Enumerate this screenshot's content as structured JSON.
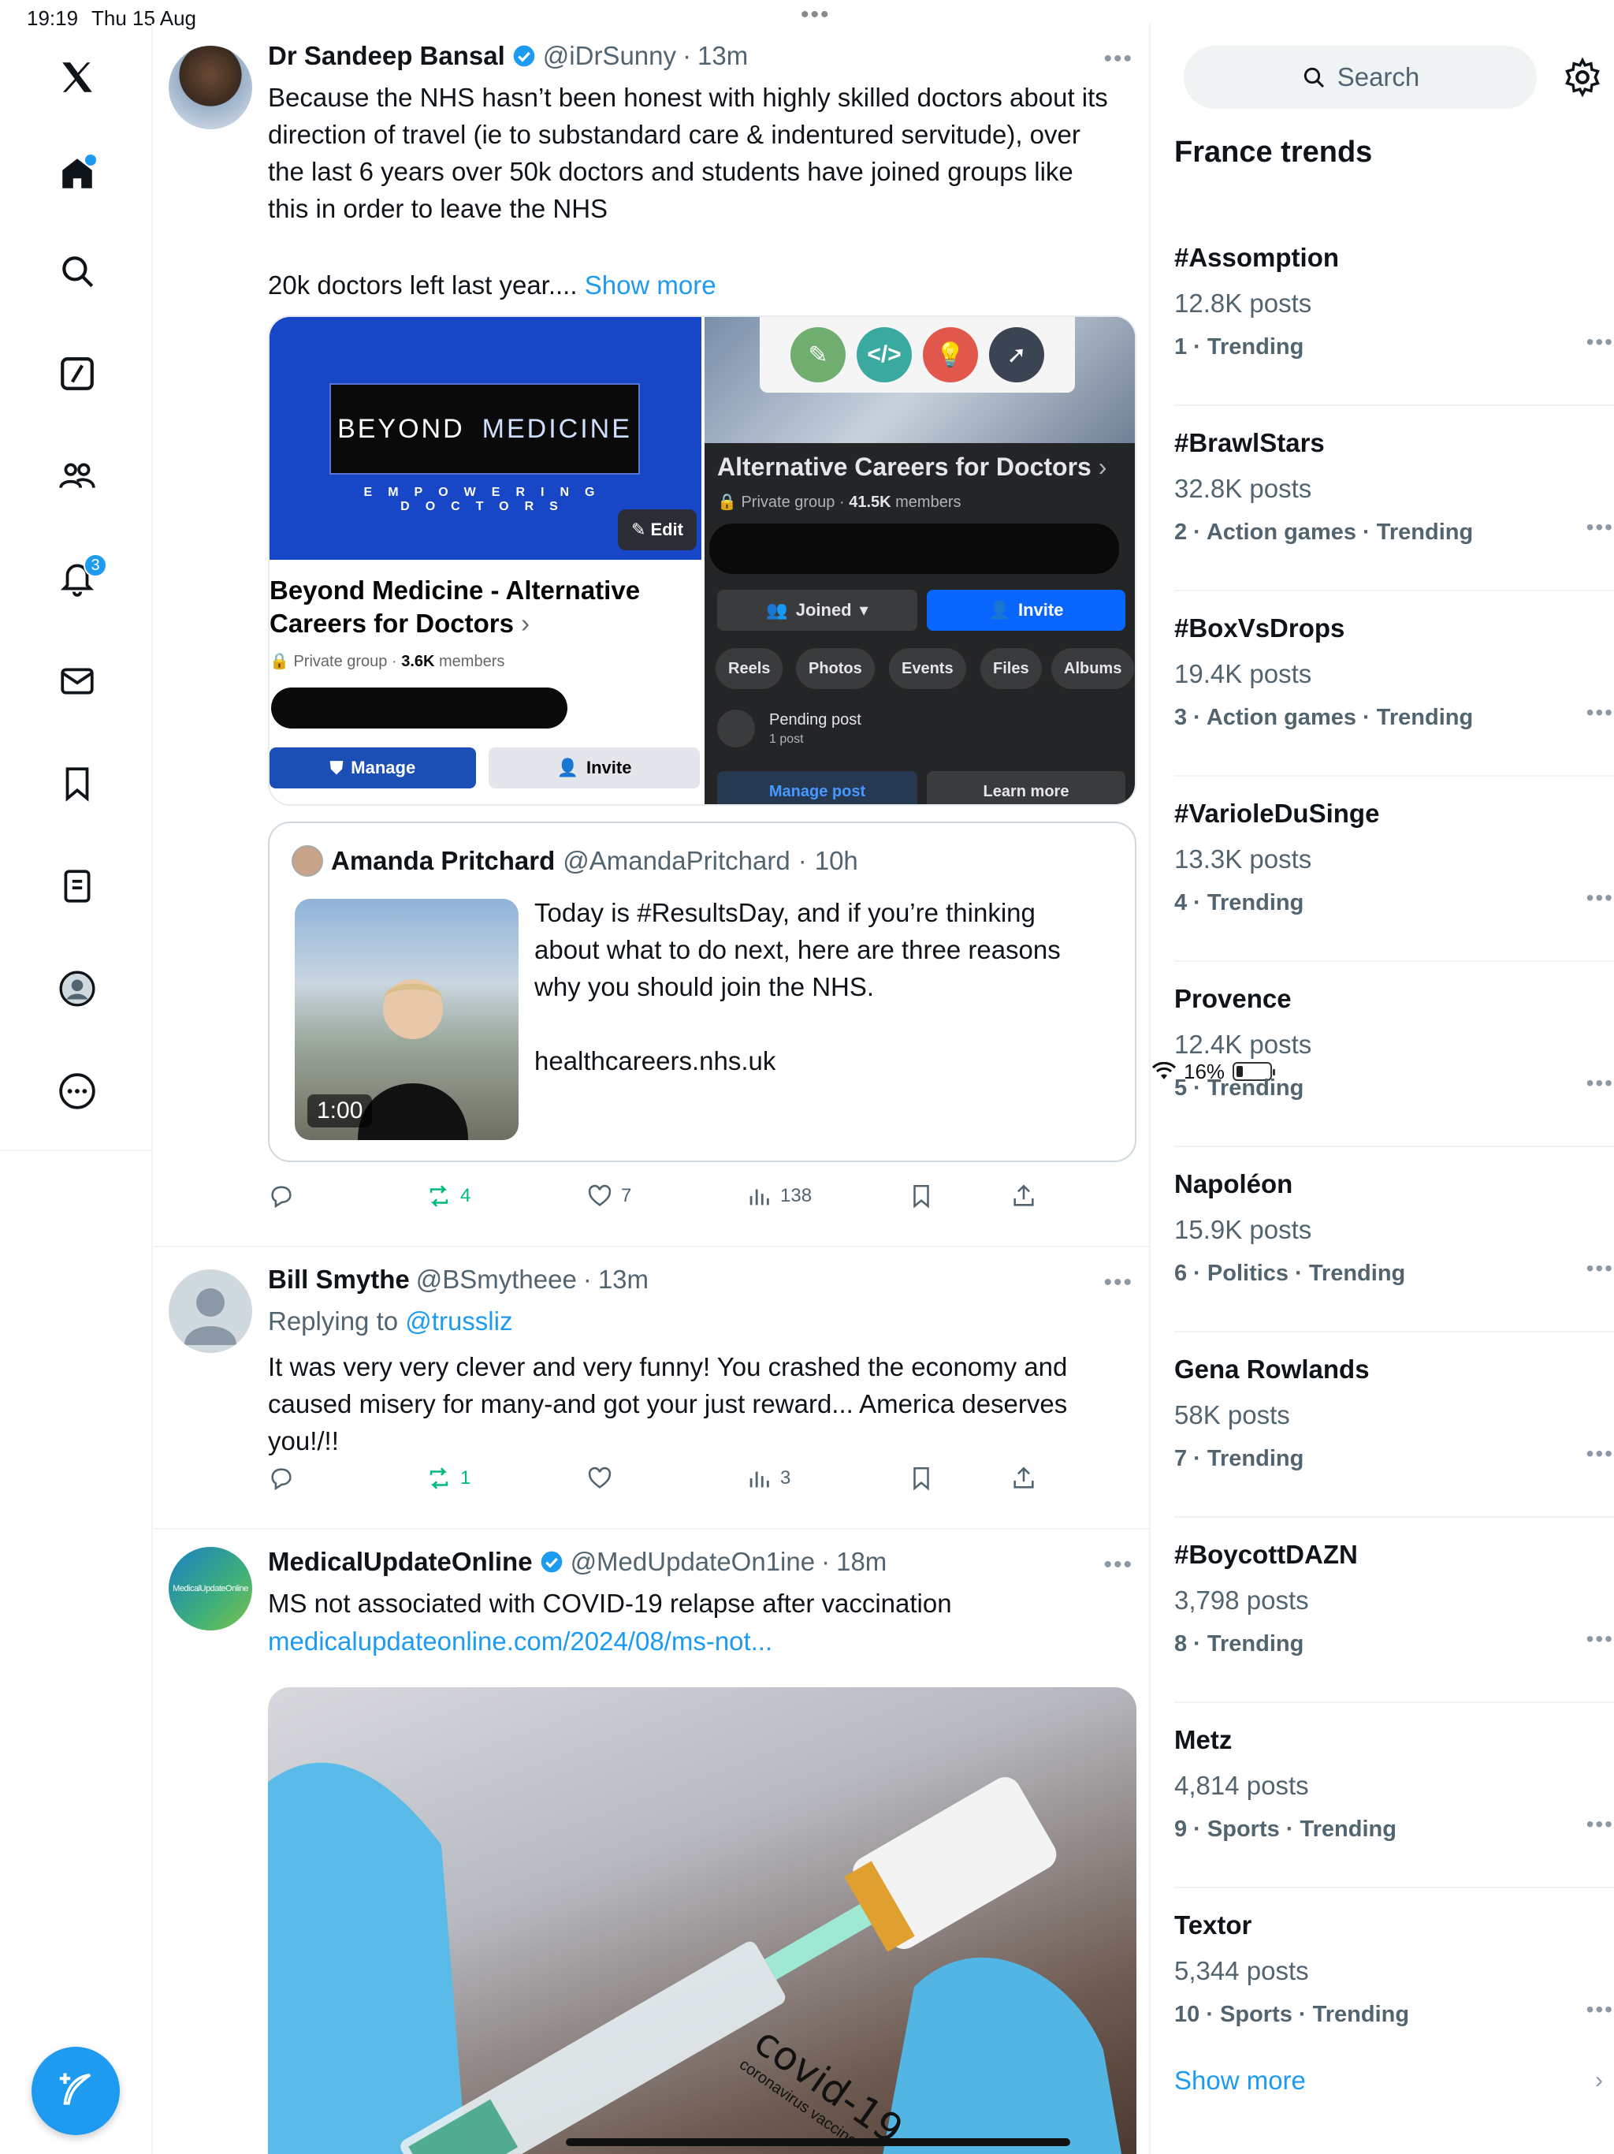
{
  "status": {
    "time": "19:19",
    "date": "Thu 15 Aug",
    "battery": "16%"
  },
  "nav": {
    "notifications_badge": "3"
  },
  "tweets": [
    {
      "name": "Dr Sandeep Bansal",
      "handle": "@iDrSunny",
      "sep": "·",
      "when": "13m",
      "text": "Because the NHS hasn’t been honest with highly skilled doctors about its direction of travel (ie to substandard care & indentured servitude), over the last 6 years over 50k doctors and students have joined groups like this in order to leave the NHS",
      "text2": "20k doctors left last year....",
      "show_more": "Show more",
      "media": {
        "left": {
          "banner_word1": "BEYOND",
          "banner_word2": "MEDICINE",
          "tagline": "EMPOWERING DOCTORS",
          "edit": "Edit",
          "title": "Beyond Medicine - Alternative Careers for Doctors",
          "chevron": "›",
          "privacy": "Private group ·",
          "members_count": "3.6K",
          "members_label": "members",
          "manage": "Manage",
          "invite": "Invite"
        },
        "right": {
          "title": "Alternative Careers for Doctors",
          "chevron": "›",
          "privacy": "Private group ·",
          "members_count": "41.5K",
          "members_label": "members",
          "joined": "Joined",
          "invite": "Invite",
          "chips": [
            "Reels",
            "Photos",
            "Events",
            "Files",
            "Albums"
          ],
          "pending_title": "Pending post",
          "pending_count": "1 post",
          "manage_post": "Manage post",
          "learn_more": "Learn more"
        }
      },
      "quote": {
        "name": "Amanda Pritchard",
        "handle": "@AmandaPritchard",
        "sep": "·",
        "when": "10h",
        "duration": "1:00",
        "text1": "Today is #ResultsDay, and if you’re thinking about what to do next, here are three reasons why you should join the NHS.",
        "text2": "healthcareers.nhs.uk"
      },
      "retweets": "4",
      "likes": "7",
      "views": "138"
    },
    {
      "name": "Bill Smythe",
      "handle": "@BSmytheee",
      "sep": "·",
      "when": "13m",
      "replying_prefix": "Replying to",
      "replying_to": "@trussliz",
      "text": "It was very very clever and very funny! You crashed the economy and caused misery for many-and got your just reward... America deserves you!/!!",
      "retweets": "1",
      "views": "3"
    },
    {
      "name": "MedicalUpdateOnline",
      "handle": "@MedUpdateOn1ine",
      "sep": "·",
      "when": "18m",
      "avatar_text": "MedicalUpdateOnline",
      "text": "MS not associated with COVID-19 relapse after vaccination",
      "link": "medicalupdateonline.com/2024/08/ms-not...",
      "image_label1": "covid-19",
      "image_label2": "coronavirus vaccine"
    }
  ],
  "sidebar": {
    "search_placeholder": "Search",
    "trends_title": "France trends",
    "trends": [
      {
        "name": "#Assomption",
        "posts": "12.8K posts",
        "meta": "1 · Trending"
      },
      {
        "name": "#BrawlStars",
        "posts": "32.8K posts",
        "meta": "2 · Action games · Trending"
      },
      {
        "name": "#BoxVsDrops",
        "posts": "19.4K posts",
        "meta": "3 · Action games · Trending"
      },
      {
        "name": "#VarioleDuSinge",
        "posts": "13.3K posts",
        "meta": "4 · Trending"
      },
      {
        "name": "Provence",
        "posts": "12.4K posts",
        "meta": "5 · Trending"
      },
      {
        "name": "Napoléon",
        "posts": "15.9K posts",
        "meta": "6 · Politics · Trending"
      },
      {
        "name": "Gena Rowlands",
        "posts": "58K posts",
        "meta": "7 · Trending"
      },
      {
        "name": "#BoycottDAZN",
        "posts": "3,798 posts",
        "meta": "8 · Trending"
      },
      {
        "name": "Metz",
        "posts": "4,814 posts",
        "meta": "9 · Sports · Trending"
      },
      {
        "name": "Textor",
        "posts": "5,344 posts",
        "meta": "10 · Sports · Trending"
      }
    ],
    "show_more": "Show more"
  },
  "colors": {
    "accent": "#1d9bf0",
    "retweet": "#00ba7c",
    "muted": "#536471"
  }
}
